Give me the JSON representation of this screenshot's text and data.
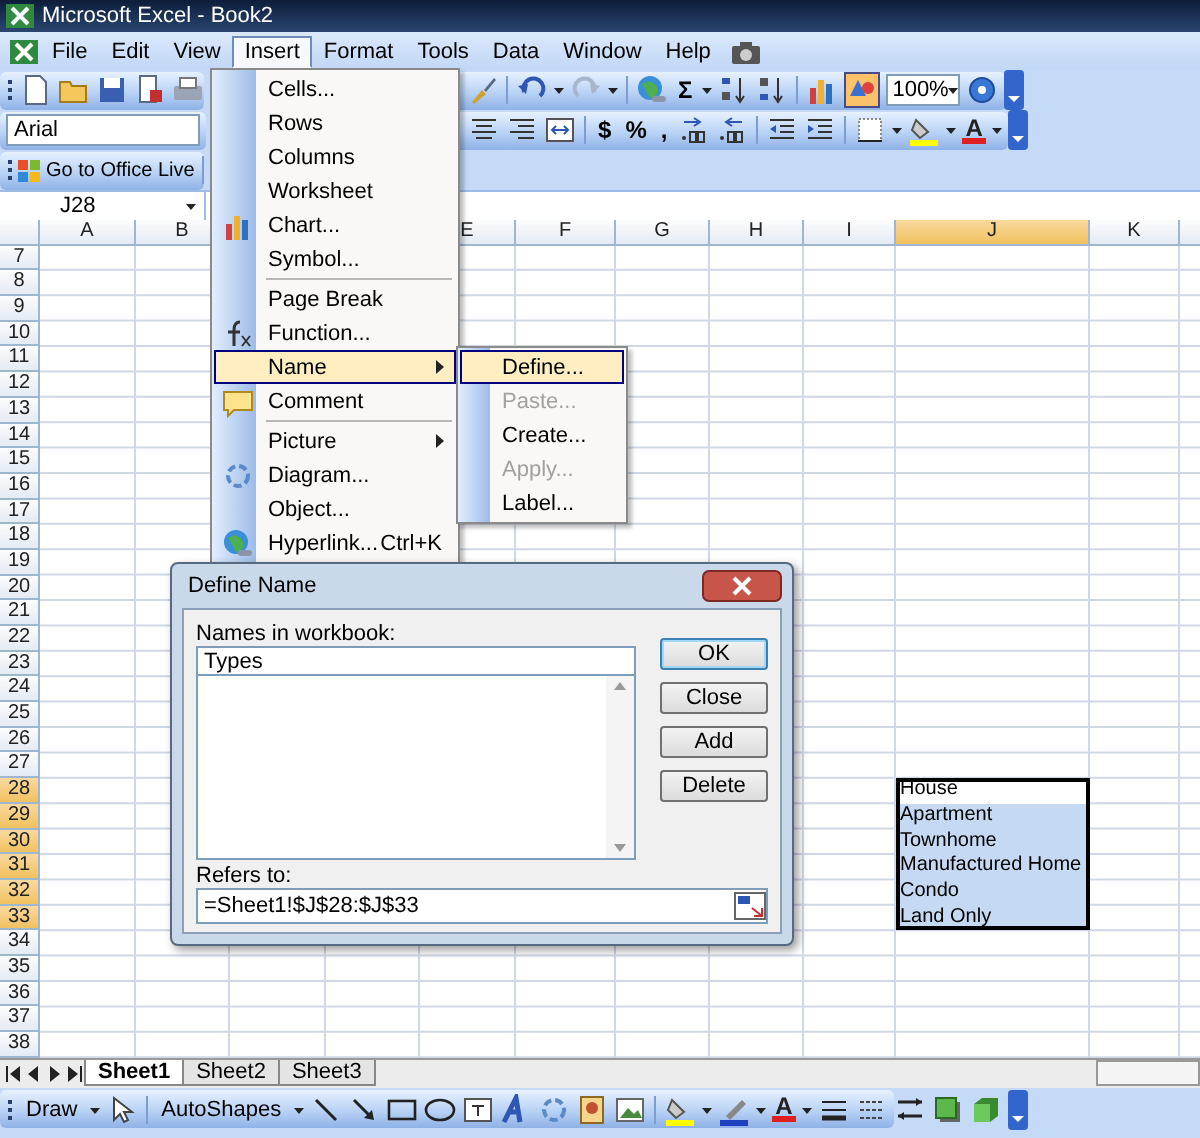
{
  "window": {
    "title": "Microsoft Excel - Book2"
  },
  "menu_bar": [
    {
      "label": "File",
      "selected": false
    },
    {
      "label": "Edit",
      "selected": false
    },
    {
      "label": "View",
      "selected": false
    },
    {
      "label": "Insert",
      "selected": true
    },
    {
      "label": "Format",
      "selected": false
    },
    {
      "label": "Tools",
      "selected": false
    },
    {
      "label": "Data",
      "selected": false
    },
    {
      "label": "Window",
      "selected": false
    },
    {
      "label": "Help",
      "selected": false
    }
  ],
  "standard_toolbar": {
    "autosum": "Σ",
    "zoom": "100%"
  },
  "formatting_toolbar": {
    "font": "Arial",
    "currency": "$",
    "percent": "%",
    "comma": ",",
    "font_color": "A"
  },
  "office_live_toolbar": {
    "link": "Go to Office Live"
  },
  "name_box": "J28",
  "columns": [
    {
      "label": "A",
      "selected": false
    },
    {
      "label": "B",
      "selected": false
    },
    {
      "label": "E",
      "selected": false
    },
    {
      "label": "F",
      "selected": false
    },
    {
      "label": "G",
      "selected": false
    },
    {
      "label": "H",
      "selected": false
    },
    {
      "label": "I",
      "selected": false
    },
    {
      "label": "J",
      "selected": true
    },
    {
      "label": "K",
      "selected": false
    }
  ],
  "rows": [
    {
      "label": "7",
      "selected": false
    },
    {
      "label": "8",
      "selected": false
    },
    {
      "label": "9",
      "selected": false
    },
    {
      "label": "10",
      "selected": false
    },
    {
      "label": "11",
      "selected": false
    },
    {
      "label": "12",
      "selected": false
    },
    {
      "label": "13",
      "selected": false
    },
    {
      "label": "14",
      "selected": false
    },
    {
      "label": "15",
      "selected": false
    },
    {
      "label": "16",
      "selected": false
    },
    {
      "label": "17",
      "selected": false
    },
    {
      "label": "18",
      "selected": false
    },
    {
      "label": "19",
      "selected": false
    },
    {
      "label": "20",
      "selected": false
    },
    {
      "label": "21",
      "selected": false
    },
    {
      "label": "22",
      "selected": false
    },
    {
      "label": "23",
      "selected": false
    },
    {
      "label": "24",
      "selected": false
    },
    {
      "label": "25",
      "selected": false
    },
    {
      "label": "26",
      "selected": false
    },
    {
      "label": "27",
      "selected": false
    },
    {
      "label": "28",
      "selected": true,
      "j": "House",
      "active": true
    },
    {
      "label": "29",
      "selected": true,
      "j": "Apartment",
      "active": false
    },
    {
      "label": "30",
      "selected": true,
      "j": "Townhome",
      "active": false
    },
    {
      "label": "31",
      "selected": true,
      "j": "Manufactured Home",
      "active": false
    },
    {
      "label": "32",
      "selected": true,
      "j": "Condo",
      "active": false
    },
    {
      "label": "33",
      "selected": true,
      "j": "Land Only",
      "active": false
    },
    {
      "label": "34",
      "selected": false
    },
    {
      "label": "35",
      "selected": false
    },
    {
      "label": "36",
      "selected": false
    },
    {
      "label": "37",
      "selected": false
    },
    {
      "label": "38",
      "selected": false
    }
  ],
  "insert_menu": [
    {
      "label": "Cells...",
      "kind": "text",
      "selected": false,
      "submenu": false,
      "separator_before": false
    },
    {
      "label": "Rows",
      "kind": "text",
      "selected": false,
      "submenu": false,
      "separator_before": false
    },
    {
      "label": "Columns",
      "kind": "text",
      "selected": false,
      "submenu": false,
      "separator_before": false
    },
    {
      "label": "Worksheet",
      "kind": "text",
      "selected": false,
      "submenu": false,
      "separator_before": false
    },
    {
      "label": "Chart...",
      "kind": "chart",
      "selected": false,
      "submenu": false,
      "separator_before": false
    },
    {
      "label": "Symbol...",
      "kind": "text",
      "selected": false,
      "submenu": false,
      "separator_before": false
    },
    {
      "label": "Page Break",
      "kind": "text",
      "selected": false,
      "submenu": false,
      "separator_before": true
    },
    {
      "label": "Function...",
      "kind": "function",
      "selected": false,
      "submenu": false,
      "separator_before": false
    },
    {
      "label": "Name",
      "kind": "text",
      "selected": true,
      "submenu": true,
      "separator_before": false
    },
    {
      "label": "Comment",
      "kind": "comment",
      "selected": false,
      "submenu": false,
      "separator_before": false
    },
    {
      "label": "Picture",
      "kind": "text",
      "selected": false,
      "submenu": true,
      "separator_before": true
    },
    {
      "label": "Diagram...",
      "kind": "diagram",
      "selected": false,
      "submenu": false,
      "separator_before": false
    },
    {
      "label": "Object...",
      "kind": "text",
      "selected": false,
      "submenu": false,
      "separator_before": false
    },
    {
      "label": "Hyperlink...",
      "kind": "hyperlink",
      "selected": false,
      "submenu": false,
      "separator_before": false,
      "shortcut": "Ctrl+K"
    }
  ],
  "name_submenu": [
    {
      "label": "Define...",
      "selected": true,
      "disabled": false
    },
    {
      "label": "Paste...",
      "selected": false,
      "disabled": true
    },
    {
      "label": "Create...",
      "selected": false,
      "disabled": false
    },
    {
      "label": "Apply...",
      "selected": false,
      "disabled": true
    },
    {
      "label": "Label...",
      "selected": false,
      "disabled": false
    }
  ],
  "dialog": {
    "title": "Define Name",
    "names_label": "Names in workbook:",
    "name_value": "Types",
    "refers_label": "Refers to:",
    "refers_value": "=Sheet1!$J$28:$J$33",
    "buttons": [
      {
        "label": "OK",
        "default": true
      },
      {
        "label": "Close",
        "default": false
      },
      {
        "label": "Add",
        "default": false
      },
      {
        "label": "Delete",
        "default": false
      }
    ]
  },
  "sheet_tabs": [
    {
      "label": "Sheet1",
      "selected": true
    },
    {
      "label": "Sheet2",
      "selected": false
    },
    {
      "label": "Sheet3",
      "selected": false
    }
  ],
  "drawing_toolbar": {
    "draw": "Draw",
    "autoshapes": "AutoShapes",
    "font_color": "A"
  }
}
